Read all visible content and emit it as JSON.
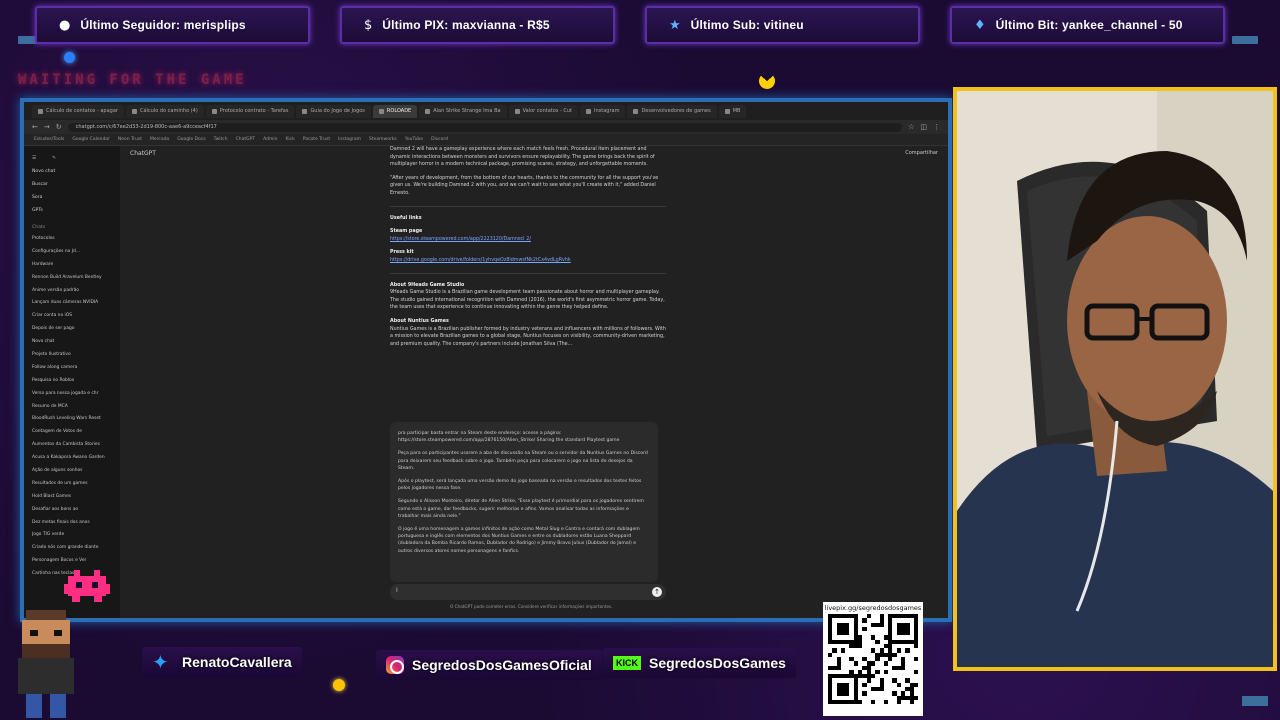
{
  "overlay": {
    "alerts": [
      {
        "icon": "user-icon",
        "text": "Último Seguidor: merisplips"
      },
      {
        "icon": "dollar-icon",
        "text": "Último PIX: maxvianna - R$5"
      },
      {
        "icon": "star-icon",
        "text": "Último Sub: vitineu"
      },
      {
        "icon": "diamond-icon",
        "text": "Último Bit: yankee_channel - 50"
      }
    ],
    "waiting_text": "WAITING FOR THE GAME",
    "socials": [
      {
        "icon": "twitter-icon",
        "name": "RenatoCavallera"
      },
      {
        "icon": "instagram-icon",
        "name": "SegredosDosGamesOficial"
      },
      {
        "icon": "kick-icon",
        "badge": "KICK",
        "name": "SegredosDosGames"
      }
    ],
    "qr_label": "livepix.gg/segredosdosgames",
    "colors": {
      "frame": "#2a6fb6",
      "cam_border": "#f2c21b",
      "background": "#1b0b33"
    }
  },
  "browser": {
    "tabs": [
      "Cálculo de contatos - apagar",
      "Cálculo do caminho (4)",
      "Protocolo contrato - Tarefas",
      "Guia do Jogo de Jogos",
      "ROLOADE",
      "Alan Strike Strange Ima Ba",
      "Valor contatos - Cut",
      "Instagram",
      "Desenvolvedores de games",
      "MB"
    ],
    "active_tab_index": 4,
    "url": "chatgpt.com/c/67ee2d33-2d19-800c-aae6-a9cceacf4f17",
    "bookmarks": [
      "Estudos/Tools",
      "Google Calendar",
      "Neon Trust",
      "Mercado",
      "Google Docs",
      "Twitch",
      "ChatGPT",
      "Admin",
      "Kick",
      "Pacote Trust",
      "Instagram",
      "Steamworks",
      "YouTube",
      "Discord"
    ]
  },
  "sidebar": {
    "top_items": [
      "Novo chat",
      "Buscar",
      "Sora",
      "GPTs"
    ],
    "section_label": "Chats",
    "history": [
      "Protocolos",
      "Configurações no Jd...",
      "Hardware",
      "Rennon Build Aravelum Bentley",
      "Anime versão padrão",
      "Lançam duas câmeras NVIDIA",
      "Criar conta no iOS",
      "Depois de ser pago",
      "Novo chat",
      "Projeto Ilustrativo",
      "Follow along camera",
      "Pesquisa no Roblox",
      "Verso para nossa jogada e chr",
      "Resumo de MCA",
      "BloodRush Leveling Wars Reset",
      "Contagem de Votos de",
      "Aumentos da Cambista Stories",
      "Acusa a Kakapora Awano Garden",
      "Ação de alguns sonhos",
      "Resultados de um games",
      "Hold Blast Games",
      "Desafiar aos bons ao",
      "Dez metas finais dos anos",
      "Jogo TIG verde",
      "Criado nós com grande diante",
      "Personagem Bocos e Ver",
      "Cartinha nas teclas"
    ]
  },
  "chat": {
    "model_label": "ChatGPT",
    "share_label": "Compartilhar",
    "paragraphs": [
      "Damned 2 will have a gameplay experience where each match feels fresh. Procedural item placement and dynamic interactions between monsters and survivors ensure replayability. The game brings back the spirit of multiplayer horror in a modern technical package, promising scares, strategy, and unforgettable moments.",
      "\"After years of development, from the bottom of our hearts, thanks to the community for all the support you've given us. We're building Damned 2 with you, and we can't wait to see what you'll create with it,\" added Daniel Ernesto."
    ],
    "useful_links_heading": "Useful links",
    "steam_label": "Steam page",
    "steam_url": "https://store.steampowered.com/app/2223120/Damned_2/",
    "presskit_label": "Press kit",
    "presskit_url": "https://drive.google.com/drive/folders/1yhvqeOz8ldmwsfNk2tCx4vdLgRvhk",
    "about_studio_heading": "About 9Heads Game Studio",
    "about_studio_text": "9Heads Game Studio is a Brazilian game development team passionate about horror and multiplayer gameplay. The studio gained international recognition with Damned (2016), the world's first asymmetric horror game. Today, the team uses that experience to continue innovating within the genre they helped define.",
    "about_nuntius_heading": "About Nuntius Games",
    "about_nuntius_text": "Nuntius Games is a Brazilian publisher formed by industry veterans and influencers with millions of followers. With a mission to elevate Brazilian games to a global stage, Nuntius focuses on visibility, community-driven marketing, and premium quality. The company's partners include Jonathan Silva (The...",
    "quote_lines": [
      "pra participar basta entrar na Steam deste endereço: acesse a página:",
      "https://store.steampowered.com/app/2876150/Alien_Strike/ Sharing the standard Playtest game",
      "Peça para os participantes usarem a aba de discussão na Steam ou o servidor da Nuntius Games no Discord para deixarem seu feedback sobre o jogo. Também peça para colocarem o jogo na lista de desejos da Steam.",
      "Após o playtest, será lançada uma versão demo do jogo baseada na versão e resultados dos testes feitos pelos jogadores nessa fase.",
      "Segundo o Alisson Monteiro, diretor de Alien Strike, \"Esse playtest é primordial para os jogadores sentirem como está o game, dar feedbacks, sugerir melhorias e afins. Vamos analisar todas as informações e trabalhar mais ainda nele.\"",
      "O jogo é uma homenagem a games infinitos de ação como Metal Slug e Contra e contará com dublagem portuguesa e inglês com elementos dos Nuntius Games e entre os dubladores estão Luana Sheppard (dubladora da Bomba Ricardo Ramos, Dublador do Rodrigo) e Jimmy Bravo Julius (Dublador do Jamal) e outros diversos atores nomes personagens e fanfics."
    ],
    "composer_placeholder": "I",
    "disclaimer": "O ChatGPT pode cometer erros. Considere verificar informações importantes."
  }
}
